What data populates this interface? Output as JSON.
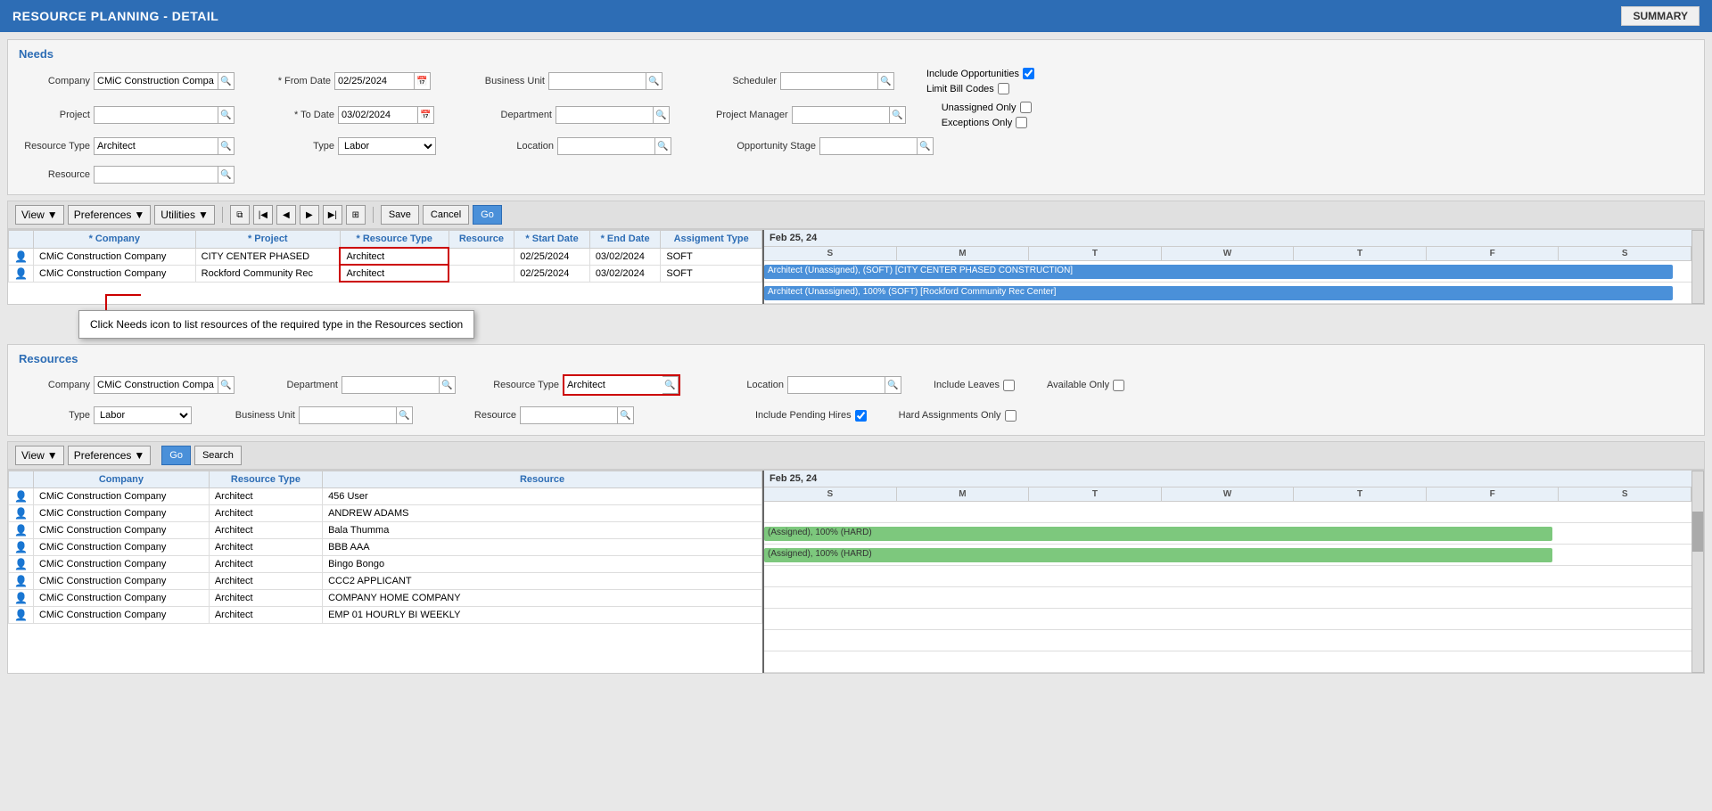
{
  "header": {
    "title": "RESOURCE PLANNING - DETAIL",
    "summary_btn": "SUMMARY"
  },
  "needs": {
    "section_title": "Needs",
    "company_label": "Company",
    "company_value": "CMiC Construction Compa",
    "project_label": "Project",
    "from_date_label": "* From Date",
    "from_date_value": "02/25/2024",
    "to_date_label": "* To Date",
    "to_date_value": "03/02/2024",
    "resource_type_label": "Resource Type",
    "resource_type_value": "Architect",
    "type_label": "Type",
    "type_value": "Labor",
    "resource_label": "Resource",
    "business_unit_label": "Business Unit",
    "department_label": "Department",
    "location_label": "Location",
    "scheduler_label": "Scheduler",
    "project_manager_label": "Project Manager",
    "opportunity_stage_label": "Opportunity Stage",
    "include_opps_label": "Include Opportunities",
    "limit_bill_label": "Limit Bill Codes",
    "unassigned_label": "Unassigned Only",
    "exceptions_label": "Exceptions Only"
  },
  "needs_toolbar": {
    "view_label": "View",
    "preferences_label": "Preferences",
    "utilities_label": "Utilities",
    "save_label": "Save",
    "cancel_label": "Cancel",
    "go_label": "Go"
  },
  "needs_grid": {
    "columns": [
      "* Company",
      "* Project",
      "* Resource Type",
      "Resource",
      "* Start Date",
      "* End Date",
      "Assignment Type"
    ],
    "rows": [
      {
        "company": "CMiC Construction Company",
        "project": "CITY CENTER PHASED",
        "resource_type": "Architect",
        "resource": "",
        "start_date": "02/25/2024",
        "end_date": "03/02/2024",
        "assignment_type": "SOFT",
        "highlighted": true
      },
      {
        "company": "CMiC Construction Company",
        "project": "Rockford Community Rec",
        "resource_type": "Architect",
        "resource": "",
        "start_date": "02/25/2024",
        "end_date": "03/02/2024",
        "assignment_type": "SOFT",
        "highlighted": false
      }
    ],
    "gantt_header": "Feb 25, 24",
    "gantt_days": [
      "S",
      "M",
      "T",
      "W",
      "T",
      "F",
      "S"
    ],
    "gantt_bars": [
      {
        "text": "Architect (Unassigned), (SOFT) [CITY CENTER PHASED CONSTRUCTION]",
        "color": "blue",
        "left_pct": 0,
        "width_pct": 100
      },
      {
        "text": "Architect (Unassigned), 100% (SOFT) [Rockford Community Rec Center]",
        "color": "blue",
        "left_pct": 0,
        "width_pct": 100
      }
    ]
  },
  "tooltip": {
    "text": "Click Needs icon to list resources of the required type in the Resources section"
  },
  "resources": {
    "section_title": "Resources",
    "company_label": "Company",
    "company_value": "CMiC Construction Compa",
    "department_label": "Department",
    "resource_type_label": "Resource Type",
    "resource_type_value": "Architect",
    "location_label": "Location",
    "type_label": "Type",
    "type_value": "Labor",
    "business_unit_label": "Business Unit",
    "resource_label": "Resource",
    "include_leaves_label": "Include Leaves",
    "available_only_label": "Available Only",
    "include_pending_label": "Include Pending Hires",
    "include_pending_checked": true,
    "hard_assignments_label": "Hard Assignments Only"
  },
  "resources_toolbar": {
    "view_label": "View",
    "preferences_label": "Preferences",
    "go_label": "Go",
    "search_label": "Search"
  },
  "resources_grid": {
    "columns": [
      "Company",
      "Resource Type",
      "Resource"
    ],
    "rows": [
      {
        "company": "CMiC Construction Company",
        "resource_type": "Architect",
        "resource": "456 User"
      },
      {
        "company": "CMiC Construction Company",
        "resource_type": "Architect",
        "resource": "ANDREW ADAMS"
      },
      {
        "company": "CMiC Construction Company",
        "resource_type": "Architect",
        "resource": "Bala Thumma"
      },
      {
        "company": "CMiC Construction Company",
        "resource_type": "Architect",
        "resource": "BBB AAA"
      },
      {
        "company": "CMiC Construction Company",
        "resource_type": "Architect",
        "resource": "Bingo Bongo"
      },
      {
        "company": "CMiC Construction Company",
        "resource_type": "Architect",
        "resource": "CCC2 APPLICANT"
      },
      {
        "company": "CMiC Construction Company",
        "resource_type": "Architect",
        "resource": "COMPANY HOME COMPANY"
      },
      {
        "company": "CMiC Construction Company",
        "resource_type": "Architect",
        "resource": "EMP 01 HOURLY BI WEEKLY"
      }
    ],
    "gantt_header": "Feb 25, 24",
    "gantt_days": [
      "S",
      "M",
      "T",
      "W",
      "T",
      "F",
      "S"
    ],
    "gantt_bars": [
      {
        "row": 1,
        "text": "(Assigned), 100% (HARD)",
        "color": "green"
      },
      {
        "row": 2,
        "text": "(Assigned), 100% (HARD)",
        "color": "green"
      }
    ]
  }
}
